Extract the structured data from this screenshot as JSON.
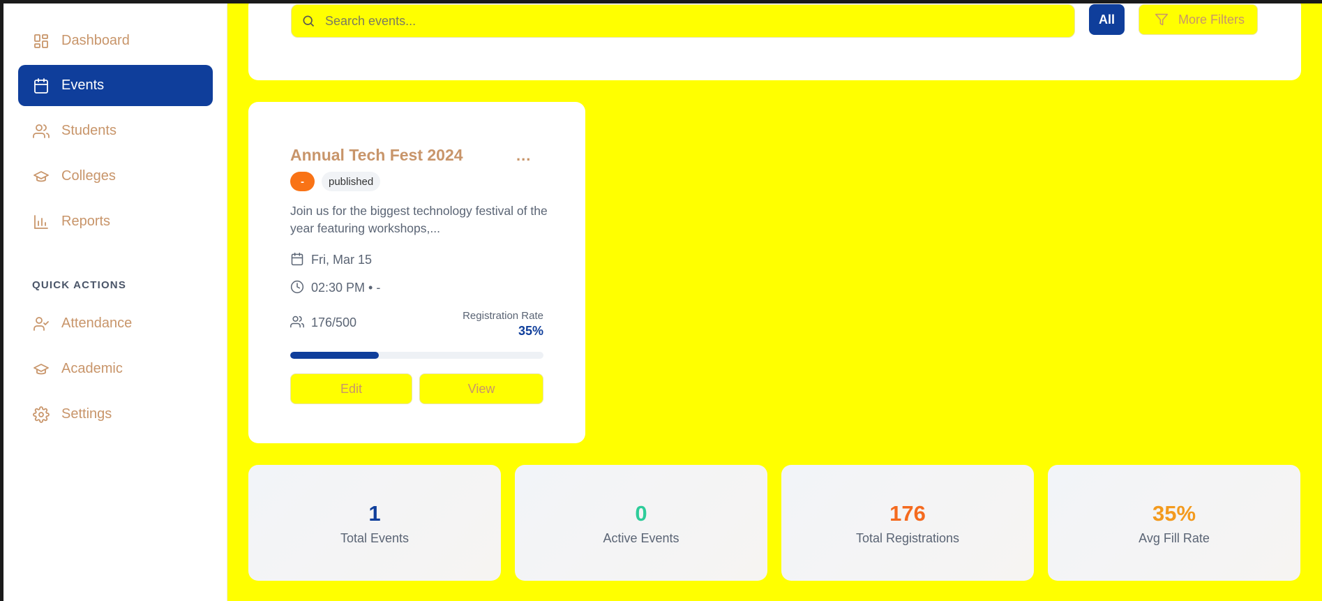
{
  "sidebar": {
    "items": [
      {
        "label": "Dashboard",
        "icon": "dashboard-icon"
      },
      {
        "label": "Events",
        "icon": "calendar-icon",
        "active": true
      },
      {
        "label": "Students",
        "icon": "users-icon"
      },
      {
        "label": "Colleges",
        "icon": "graduation-cap-icon"
      },
      {
        "label": "Reports",
        "icon": "bar-chart-icon"
      }
    ],
    "quick_actions_label": "QUICK ACTIONS",
    "quick_actions": [
      {
        "label": "Attendance",
        "icon": "user-check-icon"
      },
      {
        "label": "Academic",
        "icon": "graduation-cap-icon"
      },
      {
        "label": "Settings",
        "icon": "gear-icon"
      }
    ]
  },
  "filters": {
    "search_placeholder": "Search events...",
    "all_label": "All",
    "more_filters_label": "More Filters"
  },
  "event": {
    "title": "Annual Tech Fest 2024",
    "menu": "...",
    "type_badge": "-",
    "status_badge": "published",
    "description": "Join us for the biggest technology festival of the year featuring workshops,...",
    "date": "Fri, Mar 15",
    "time": "02:30 PM • -",
    "registrations": "176/500",
    "registration_rate_label": "Registration Rate",
    "registration_rate": "35%",
    "registration_rate_value": 0.35,
    "edit_label": "Edit",
    "view_label": "View"
  },
  "stats": [
    {
      "value": "1",
      "label": "Total Events",
      "color": "#0f3e9b"
    },
    {
      "value": "0",
      "label": "Active Events",
      "color": "#2ecc9a"
    },
    {
      "value": "176",
      "label": "Total Registrations",
      "color": "#f46a1f"
    },
    {
      "value": "35%",
      "label": "Avg Fill Rate",
      "color": "#f39a1e"
    }
  ],
  "colors": {
    "accent": "#0f3e9b",
    "background": "#ffff00",
    "muted_text": "#c8956a"
  }
}
